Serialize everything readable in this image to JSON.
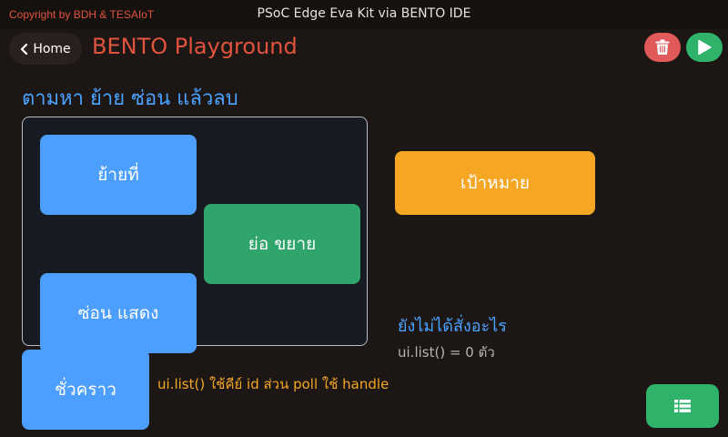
{
  "header": {
    "copyright": "Copyright by BDH & TESAIoT",
    "window_title": "PSoC Edge Eva Kit via BENTO IDE"
  },
  "nav": {
    "home_label": "Home",
    "app_title": "BENTO Playground"
  },
  "main": {
    "section_title": "ตามหา ย้าย ซ่อน แล้วลบ",
    "tiles": {
      "move": "ย้ายที่",
      "resize": "ย่อ ขยาย",
      "hide_show": "ซ่อน แสดง",
      "target": "เป้าหมาย",
      "temporary": "ชั่วคราว"
    },
    "status_title": "ยังไม่ได้สั่งอะไร",
    "status_count": "ui.list() = 0 ตัว",
    "hint": "ui.list() ใช้คีย์ id ส่วน poll ใช้ handle"
  },
  "colors": {
    "accent_red": "#e0533c",
    "accent_blue": "#4d9fff",
    "accent_green": "#2fb36a",
    "accent_orange": "#f5a623"
  },
  "icons": {
    "home": "chevron-left-icon",
    "delete": "trash-icon",
    "run": "play-icon",
    "list": "list-icon"
  }
}
